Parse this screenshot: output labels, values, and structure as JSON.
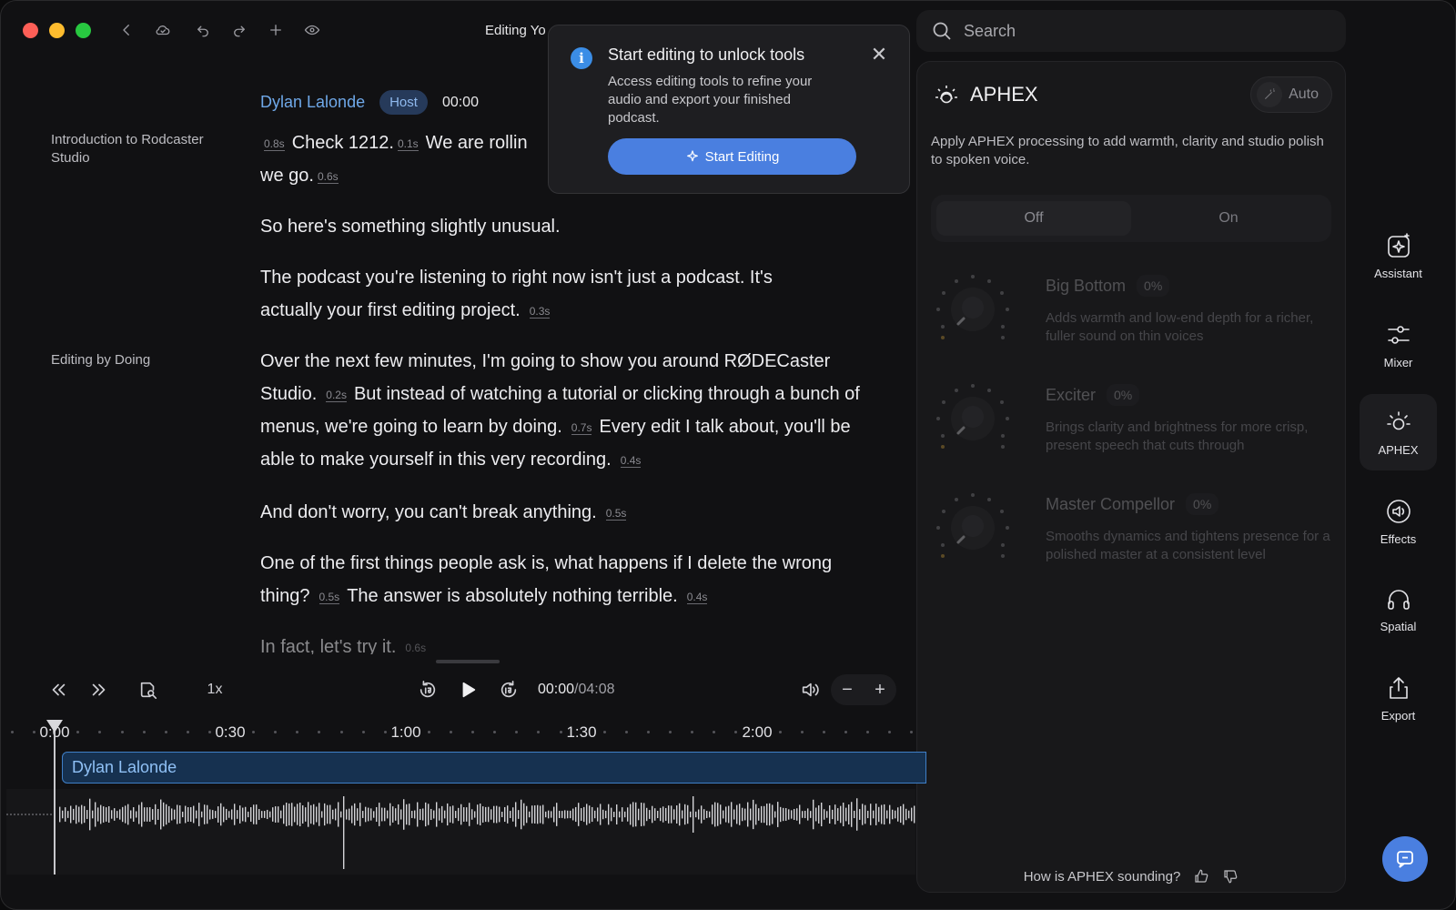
{
  "window": {
    "title": "Editing Yo"
  },
  "transcript": {
    "sections": [
      {
        "label": "Introduction to Rodcaster Studio"
      },
      {
        "label": "Editing by Doing"
      }
    ],
    "speaker": {
      "name": "Dylan Lalonde",
      "badge": "Host",
      "time": "00:00"
    },
    "p1": {
      "g1": "0.8s",
      "t1": "Check 1212.",
      "g2": "0.1s",
      "t2": "We are rollin",
      "t3": "we go.",
      "g3": "0.6s"
    },
    "p2": {
      "t1": "So here's something slightly unusual."
    },
    "p3": {
      "t1": "The podcast you're listening to right now isn't just a podcast. It's actually your first editing project.",
      "g1": "0.3s"
    },
    "p4": {
      "t1": "Over the next few minutes, I'm going to show you around RØDECaster Studio.",
      "g1": "0.2s",
      "t2": "But instead of watching a tutorial or clicking through a bunch of menus, we're going to learn by doing.",
      "g2": "0.7s",
      "t3": "Every edit I talk about, you'll be able to make yourself in this very recording.",
      "g3": "0.4s"
    },
    "p5": {
      "t1": "And don't worry, you can't break anything.",
      "g1": "0.5s"
    },
    "p6": {
      "t1": "One of the first things people ask is, what happens if I delete the wrong thing?",
      "g1": "0.5s",
      "t2": "The answer is absolutely nothing terrible.",
      "g2": "0.4s"
    },
    "p7": {
      "t1": "In fact, let's try it.",
      "g1": "0.6s"
    }
  },
  "popover": {
    "title": "Start editing to unlock tools",
    "body": "Access editing tools to refine your audio and export your finished podcast.",
    "button": "Start Editing"
  },
  "search": {
    "placeholder": "Search"
  },
  "aphex": {
    "title": "APHEX",
    "auto_label": "Auto",
    "description": "Apply APHEX processing to add warmth, clarity and studio polish to spoken voice.",
    "toggle": {
      "off": "Off",
      "on": "On",
      "selected": "Off"
    },
    "effects": [
      {
        "name": "Big Bottom",
        "value": "0%",
        "desc": "Adds warmth and low-end depth for a richer, fuller sound on thin voices"
      },
      {
        "name": "Exciter",
        "value": "0%",
        "desc": "Brings clarity and brightness for more crisp, present speech that cuts through"
      },
      {
        "name": "Master Compellor",
        "value": "0%",
        "desc": "Smooths dynamics and tightens presence for a polished master at a consistent level"
      }
    ],
    "feedback": "How is APHEX sounding?"
  },
  "rail": {
    "items": [
      {
        "label": "Assistant",
        "icon": "sparkle-icon"
      },
      {
        "label": "Mixer",
        "icon": "sliders-icon"
      },
      {
        "label": "APHEX",
        "icon": "aphex-icon"
      },
      {
        "label": "Effects",
        "icon": "speaker-icon"
      },
      {
        "label": "Spatial",
        "icon": "headphones-icon"
      },
      {
        "label": "Export",
        "icon": "share-icon"
      }
    ],
    "selected": "APHEX"
  },
  "transport": {
    "speed": "1x",
    "current": "00:00",
    "total": "/04:08",
    "zoom_out": "−",
    "zoom_in": "+"
  },
  "timeline": {
    "ticks": [
      "0:00",
      "0:30",
      "1:00",
      "1:30",
      "2:00"
    ],
    "track_name": "Dylan Lalonde",
    "playhead_position": "0:00"
  },
  "colors": {
    "accent": "#4a7fe0",
    "speaker": "#6fa8e8",
    "track_fill": "#163150",
    "track_border": "#3f7fc7"
  }
}
